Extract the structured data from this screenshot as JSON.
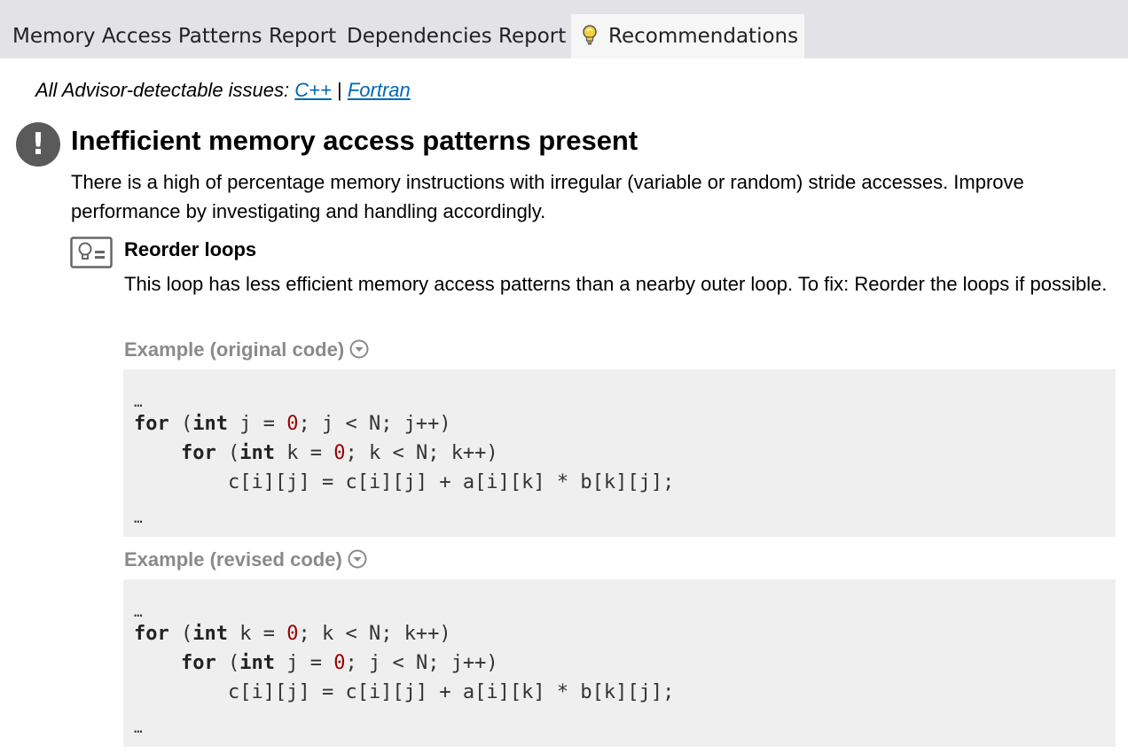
{
  "tabs": [
    {
      "label": "Memory Access Patterns Report"
    },
    {
      "label": "Dependencies Report"
    },
    {
      "label": "Recommendations",
      "icon": "lightbulb-icon",
      "active": true
    }
  ],
  "issues_line": {
    "prefix": "All Advisor-detectable issues:",
    "link_cpp": "C++",
    "separator": "|",
    "link_fortran": "Fortran"
  },
  "issue": {
    "icon": "exclamation-icon",
    "title": "Inefficient memory access patterns present",
    "description": "There is a high of percentage memory instructions with irregular (variable or random) stride accesses. Improve performance by investigating and handling accordingly."
  },
  "recommendation": {
    "icon": "recommendation-icon",
    "title": "Reorder loops",
    "description": "This loop has less efficient memory access patterns than a nearby outer loop. To fix: Reorder the loops if possible.",
    "example_original_label": "Example (original code)",
    "example_revised_label": "Example (revised code)",
    "original_code": {
      "ellipsis_top": "…",
      "outer_kw": "for",
      "outer_rest_1": " (",
      "outer_type": "int",
      "outer_rest_2": " j = ",
      "outer_zero": "0",
      "outer_rest_3": "; j < N; j++)",
      "inner_kw": "for",
      "inner_rest_1": " (",
      "inner_type": "int",
      "inner_rest_2": " k = ",
      "inner_zero": "0",
      "inner_rest_3": "; k < N; k++)",
      "body": "c[i][j] = c[i][j] + a[i][k] * b[k][j];",
      "ellipsis_bottom": "…"
    },
    "revised_code": {
      "ellipsis_top": "…",
      "outer_kw": "for",
      "outer_rest_1": " (",
      "outer_type": "int",
      "outer_rest_2": " k = ",
      "outer_zero": "0",
      "outer_rest_3": "; k < N; k++)",
      "inner_kw": "for",
      "inner_rest_1": " (",
      "inner_type": "int",
      "inner_rest_2": " j = ",
      "inner_zero": "0",
      "inner_rest_3": "; j < N; j++)",
      "body": "c[i][j] = c[i][j] + a[i][k] * b[k][j];",
      "ellipsis_bottom": "…"
    }
  },
  "colors": {
    "link": "#0068b5",
    "tabbar_bg": "#e3e3e7",
    "code_bg": "#efefef",
    "code_number": "#9b0000",
    "example_label": "#8a8a8a"
  }
}
